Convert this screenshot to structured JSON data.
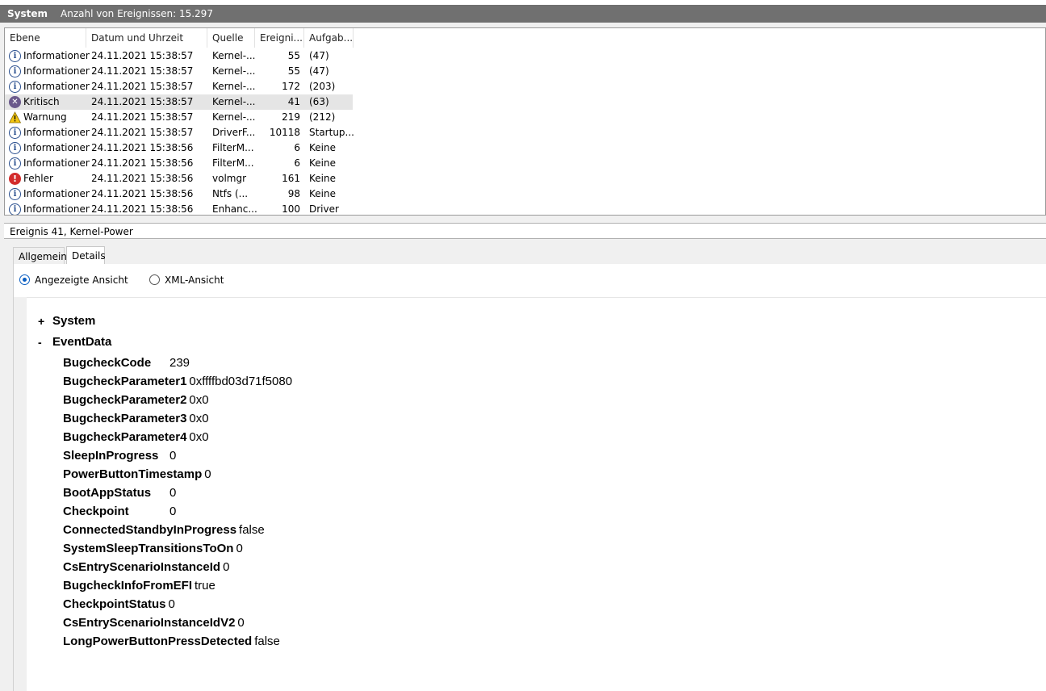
{
  "title_bar": {
    "name": "System",
    "count_text": "Anzahl von Ereignissen: 15.297"
  },
  "columns": [
    "Ebene",
    "Datum und Uhrzeit",
    "Quelle",
    "Ereigni...",
    "Aufgab..."
  ],
  "events": [
    {
      "icon": "info-icon",
      "level": "Informationen",
      "date": "24.11.2021 15:38:57",
      "source": "Kernel-...",
      "id": "55",
      "task": "(47)"
    },
    {
      "icon": "info-icon",
      "level": "Informationen",
      "date": "24.11.2021 15:38:57",
      "source": "Kernel-...",
      "id": "55",
      "task": "(47)"
    },
    {
      "icon": "info-icon",
      "level": "Informationen",
      "date": "24.11.2021 15:38:57",
      "source": "Kernel-...",
      "id": "172",
      "task": "(203)"
    },
    {
      "icon": "critical-icon",
      "level": "Kritisch",
      "date": "24.11.2021 15:38:57",
      "source": "Kernel-...",
      "id": "41",
      "task": "(63)"
    },
    {
      "icon": "warning-icon",
      "level": "Warnung",
      "date": "24.11.2021 15:38:57",
      "source": "Kernel-...",
      "id": "219",
      "task": "(212)"
    },
    {
      "icon": "info-icon",
      "level": "Informationen",
      "date": "24.11.2021 15:38:57",
      "source": "DriverF...",
      "id": "10118",
      "task": "Startup..."
    },
    {
      "icon": "info-icon",
      "level": "Informationen",
      "date": "24.11.2021 15:38:56",
      "source": "FilterM...",
      "id": "6",
      "task": "Keine"
    },
    {
      "icon": "info-icon",
      "level": "Informationen",
      "date": "24.11.2021 15:38:56",
      "source": "FilterM...",
      "id": "6",
      "task": "Keine"
    },
    {
      "icon": "error-icon",
      "level": "Fehler",
      "date": "24.11.2021 15:38:56",
      "source": "volmgr",
      "id": "161",
      "task": "Keine"
    },
    {
      "icon": "info-icon",
      "level": "Informationen",
      "date": "24.11.2021 15:38:56",
      "source": "Ntfs (...",
      "id": "98",
      "task": "Keine"
    },
    {
      "icon": "info-icon",
      "level": "Informationen",
      "date": "24.11.2021 15:38:56",
      "source": "Enhanc...",
      "id": "100",
      "task": "Driver"
    }
  ],
  "detail": {
    "header": "Ereignis 41, Kernel-Power",
    "tabs": [
      "Allgemein",
      "Details"
    ],
    "radios": [
      "Angezeigte Ansicht",
      "XML-Ansicht"
    ],
    "tree": {
      "system": {
        "prefix": "+",
        "label": "System"
      },
      "eventdata": {
        "prefix": "-",
        "label": "EventData"
      }
    },
    "fields": [
      {
        "key": "BugcheckCode",
        "value": "239"
      },
      {
        "key": "BugcheckParameter1",
        "value": "0xffffbd03d71f5080"
      },
      {
        "key": "BugcheckParameter2",
        "value": "0x0"
      },
      {
        "key": "BugcheckParameter3",
        "value": "0x0"
      },
      {
        "key": "BugcheckParameter4",
        "value": "0x0"
      },
      {
        "key": "SleepInProgress",
        "value": "0"
      },
      {
        "key": "PowerButtonTimestamp",
        "value": "0"
      },
      {
        "key": "BootAppStatus",
        "value": "0"
      },
      {
        "key": "Checkpoint",
        "value": "0"
      },
      {
        "key": "ConnectedStandbyInProgress",
        "value": "false"
      },
      {
        "key": "SystemSleepTransitionsToOn",
        "value": "0"
      },
      {
        "key": "CsEntryScenarioInstanceId",
        "value": "0"
      },
      {
        "key": "BugcheckInfoFromEFI",
        "value": "true"
      },
      {
        "key": "CheckpointStatus",
        "value": "0"
      },
      {
        "key": "CsEntryScenarioInstanceIdV2",
        "value": "0"
      },
      {
        "key": "LongPowerButtonPressDetected",
        "value": "false"
      }
    ]
  }
}
